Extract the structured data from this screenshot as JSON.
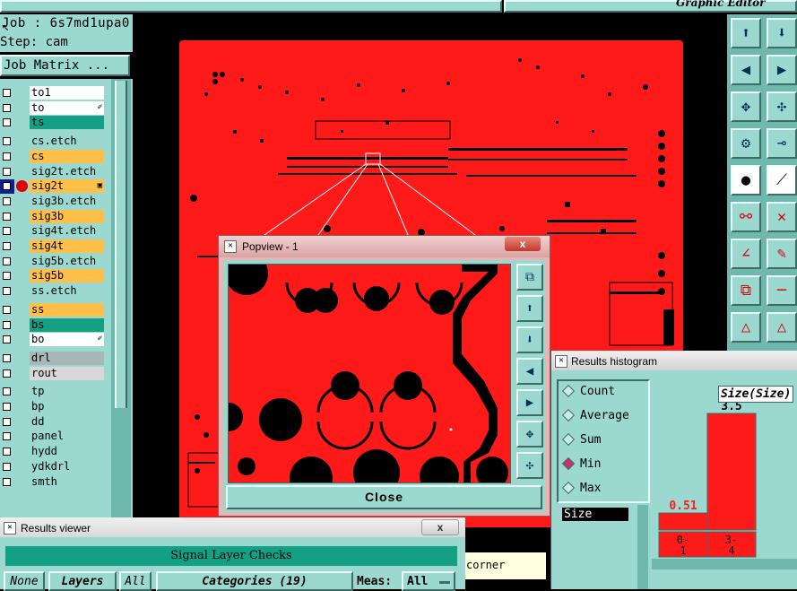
{
  "top_panel": {
    "job_label": "Job : 6s7md1upa0",
    "step_label": "Step: cam",
    "job_matrix_button": "Job Matrix ...",
    "graphic_editor_title": "Graphic Editor"
  },
  "layers": [
    {
      "name": "to1",
      "color": "#ffffff"
    },
    {
      "name": "to",
      "color": "#ffffff",
      "marker": "✐"
    },
    {
      "name": "ts",
      "color": "#14a085"
    },
    {
      "name": "cs.etch",
      "color": "#9ad8d0"
    },
    {
      "name": "cs",
      "color": "#ffc04a"
    },
    {
      "name": "sig2t.etch",
      "color": "#9ad8d0"
    },
    {
      "name": "sig2t",
      "color": "#ffc04a",
      "marker": "▣",
      "active": true
    },
    {
      "name": "sig3b.etch",
      "color": "#9ad8d0"
    },
    {
      "name": "sig3b",
      "color": "#ffc04a"
    },
    {
      "name": "sig4t.etch",
      "color": "#9ad8d0"
    },
    {
      "name": "sig4t",
      "color": "#ffc04a"
    },
    {
      "name": "sig5b.etch",
      "color": "#9ad8d0"
    },
    {
      "name": "sig5b",
      "color": "#ffc04a"
    },
    {
      "name": "ss.etch",
      "color": "#9ad8d0"
    },
    {
      "name": "ss",
      "color": "#ffc04a"
    },
    {
      "name": "bs",
      "color": "#14a085"
    },
    {
      "name": "bo",
      "color": "#ffffff",
      "marker": "✐"
    },
    {
      "name": "drl",
      "color": "#a8b8b8"
    },
    {
      "name": "rout",
      "color": "#d8d8d8"
    },
    {
      "name": "tp",
      "color": "#9ad8d0"
    },
    {
      "name": "bp",
      "color": "#9ad8d0"
    },
    {
      "name": "dd",
      "color": "#9ad8d0"
    },
    {
      "name": "panel",
      "color": "#9ad8d0"
    },
    {
      "name": "hydd",
      "color": "#9ad8d0"
    },
    {
      "name": "ydkdrl",
      "color": "#9ad8d0"
    },
    {
      "name": "smth",
      "color": "#9ad8d0"
    }
  ],
  "popview": {
    "title": "Popview - 1",
    "close_button": "Close",
    "close_icon": "x"
  },
  "histogram": {
    "title": "Results histogram",
    "options": [
      "Count",
      "Average",
      "Sum",
      "Min",
      "Max"
    ],
    "selected": "Min",
    "list_header": "Size",
    "axis_title": "Size(Size)",
    "chart_data": {
      "type": "bar",
      "categories": [
        "0-\n1",
        "3-\n4"
      ],
      "values": [
        0.51,
        3.5
      ],
      "title": "Size(Size)",
      "xlabel": "",
      "ylabel": ""
    }
  },
  "results_viewer": {
    "title": "Results viewer",
    "close_icon": "x",
    "panel_title": "Signal Layer Checks",
    "none_button": "None",
    "layers_button": "Layers",
    "all_button": "All",
    "categories_label": "Categories (19)",
    "meas_label": "Meas:",
    "meas_value": "All"
  },
  "status_fragment": "corner",
  "tool_icons": [
    "zoom-in-icon",
    "zoom-out-icon",
    "pan-left-icon",
    "pan-right-icon",
    "fit-icon",
    "fit-all-icon",
    "measure-icon",
    "snap-icon",
    "select-icon",
    "draw-line-icon",
    "connect-icon",
    "delete-icon",
    "angle-icon",
    "move-icon",
    "copy-icon",
    "line-icon",
    "triangle-icon",
    "triangle2-icon"
  ]
}
